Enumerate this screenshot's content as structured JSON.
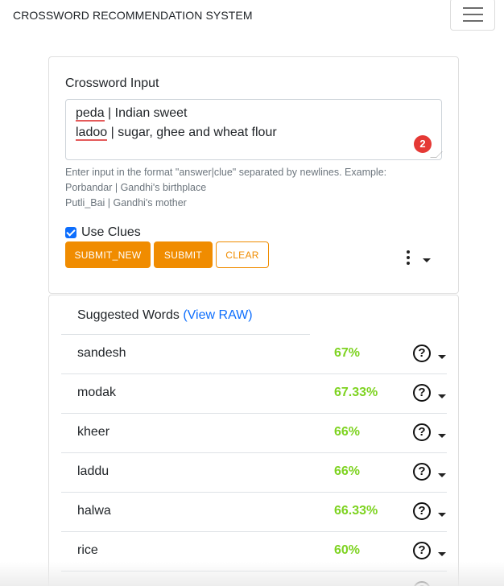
{
  "navbar": {
    "brand": "CROSSWORD RECOMMENDATION SYSTEM",
    "menu_icon": "hamburger-icon"
  },
  "input_card": {
    "title": "Crossword Input",
    "textarea_lines": [
      {
        "answer": "peda",
        "rest": " | Indian sweet"
      },
      {
        "answer": "ladoo",
        "rest": " | sugar, ghee and wheat flour"
      }
    ],
    "badge_count": "2",
    "help_text": "Enter input in the format \"answer|clue\" separated by newlines. Example:\nPorbandar | Gandhi's birthplace\nPutli_Bai | Gandhi's mother",
    "use_clues_label": "Use Clues",
    "use_clues_checked": true,
    "buttons": {
      "submit_new": "SUBMIT_NEW",
      "submit": "SUBMIT",
      "clear": "CLEAR"
    },
    "more_icon": "kebab-icon"
  },
  "suggestions": {
    "title": "Suggested Words",
    "view_raw": "(View RAW)",
    "rows": [
      {
        "word": "sandesh",
        "score": "67%"
      },
      {
        "word": "modak",
        "score": "67.33%"
      },
      {
        "word": "kheer",
        "score": "66%"
      },
      {
        "word": "laddu",
        "score": "66%"
      },
      {
        "word": "halwa",
        "score": "66.33%"
      },
      {
        "word": "rice",
        "score": "60%"
      }
    ],
    "row_icon": "help-circle-icon",
    "accent_color": "#7ed321"
  },
  "colors": {
    "primary_button": "#f08c00",
    "link": "#0d6efd",
    "badge": "#e53935"
  }
}
